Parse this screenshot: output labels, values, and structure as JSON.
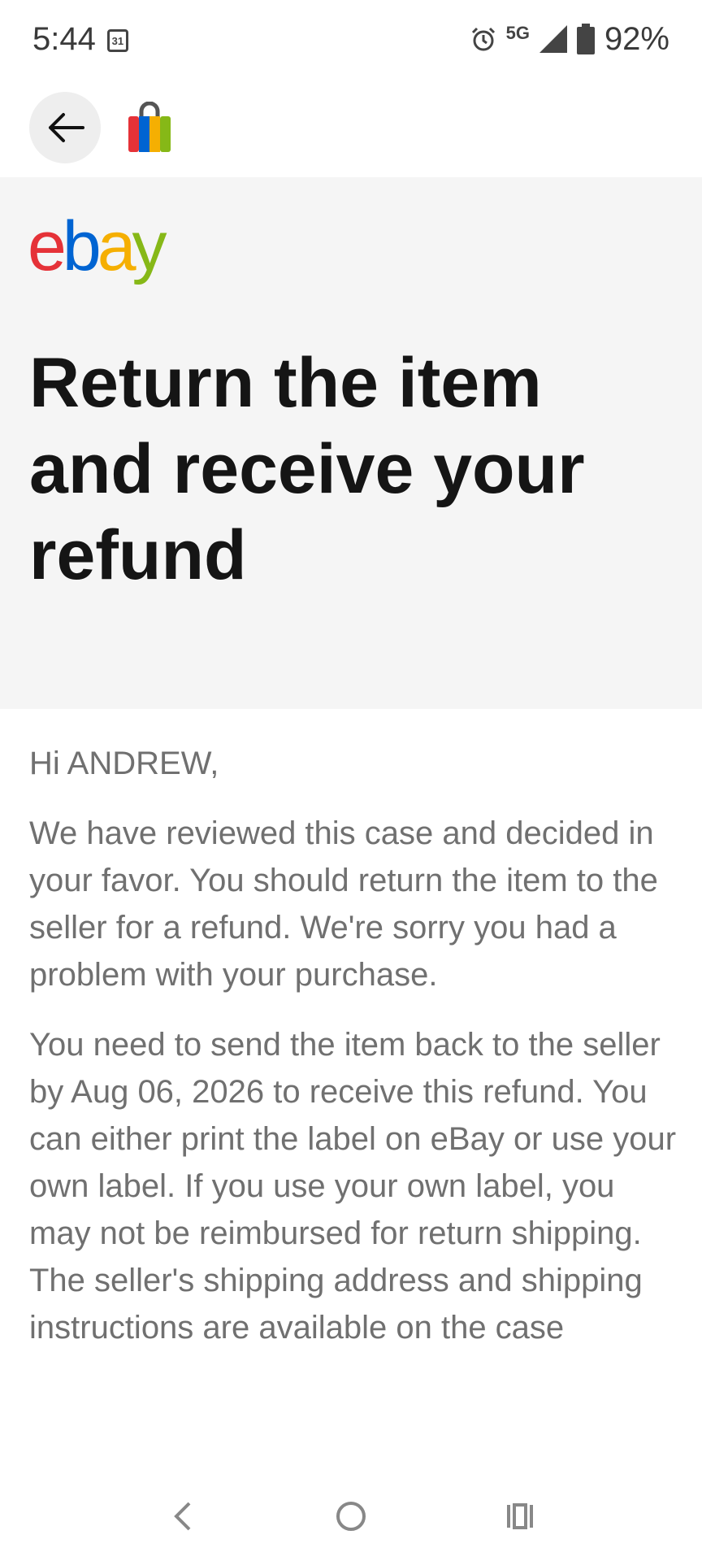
{
  "status_bar": {
    "time": "5:44",
    "calendar_day": "31",
    "network": "5G",
    "battery": "92%"
  },
  "app_header": {
    "back_icon": "arrow-left-icon",
    "app_icon": "shopping-bag-icon"
  },
  "hero": {
    "logo": {
      "e": "e",
      "b": "b",
      "a": "a",
      "y": "y"
    },
    "title": "Return the item and receive your refund"
  },
  "content": {
    "greeting": "Hi ANDREW,",
    "paragraph1": "We have reviewed this case and decided in your favor. You should return the item to the seller for a refund. We're sorry you had a problem with your purchase.",
    "paragraph2": "You need to send the item back to the seller by Aug 06, 2026 to receive this refund. You can either print the label on eBay or use your own label. If you use your own label, you may not be reimbursed for return shipping. The seller's shipping address and shipping instructions are available on the case"
  },
  "nav_bar": {
    "back": "chevron-left-icon",
    "home": "circle-home-icon",
    "recents": "recents-icon"
  },
  "colors": {
    "ebay_red": "#e53238",
    "ebay_blue": "#0064d2",
    "ebay_yellow": "#f5af02",
    "ebay_green": "#86b817",
    "hero_bg": "#f5f5f5"
  }
}
